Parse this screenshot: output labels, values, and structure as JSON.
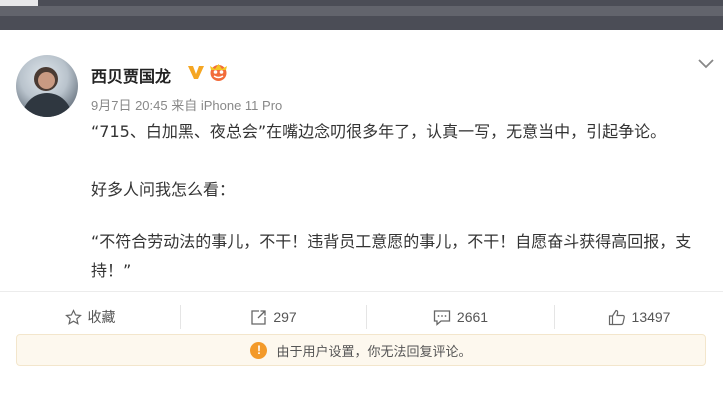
{
  "post": {
    "username": "西贝贾国龙",
    "meta": "9月7日 20:45 来自 iPhone 11 Pro",
    "paragraph1": "“715、白加黑、夜总会”在嘴边念叨很多年了，认真一写，无意当中，引起争论。",
    "paragraph2": "好多人问我怎么看：",
    "paragraph3": "“不符合劳动法的事儿，不干！违背员工意愿的事儿，不干！自愿奋斗获得高回报，支持！”"
  },
  "actions": {
    "favorite_label": "收藏",
    "repost_count": "297",
    "comment_count": "2661",
    "like_count": "13497"
  },
  "notice": {
    "icon_text": "!",
    "text": "由于用户设置，你无法回复评论。"
  },
  "colors": {
    "verified": "#f5a623",
    "warning": "#f39a2a",
    "notice_bg": "#fdf8ee"
  }
}
